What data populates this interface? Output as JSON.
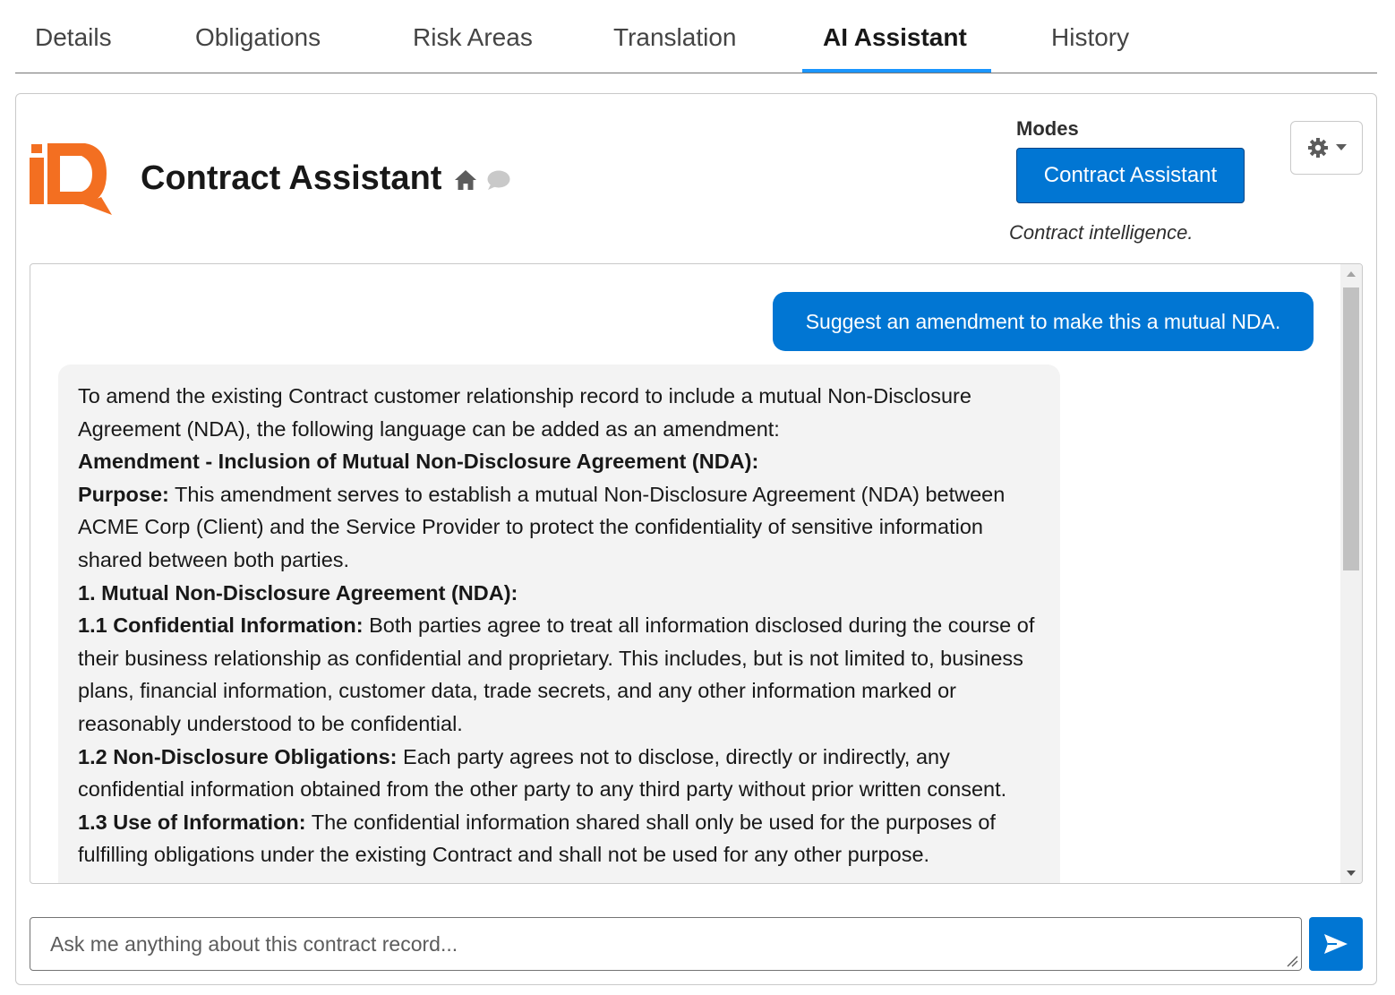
{
  "tabs": [
    {
      "label": "Details"
    },
    {
      "label": "Obligations"
    },
    {
      "label": "Risk Areas"
    },
    {
      "label": "Translation"
    },
    {
      "label": "AI Assistant",
      "active": true
    },
    {
      "label": "History"
    }
  ],
  "header": {
    "title": "Contract Assistant",
    "icons": [
      "home-icon",
      "chat-bubble-icon"
    ]
  },
  "modes": {
    "label": "Modes",
    "selected": "Contract Assistant",
    "description": "Contract intelligence."
  },
  "settings": {
    "icon": "gear-icon",
    "dropdown_icon": "caret-down-icon"
  },
  "conversation": {
    "user_message": "Suggest an amendment to make this a mutual NDA.",
    "assistant_message": {
      "intro": "To amend the existing Contract customer relationship record to include a mutual Non-Disclosure Agreement (NDA), the following language can be added as an amendment:",
      "heading": "Amendment - Inclusion of Mutual Non-Disclosure Agreement (NDA):",
      "purpose_label": "Purpose:",
      "purpose_text": " This amendment serves to establish a mutual Non-Disclosure Agreement (NDA) between ACME Corp (Client) and the Service Provider to protect the confidentiality of sensitive information shared between both parties.",
      "section1": "1. Mutual Non-Disclosure Agreement (NDA):",
      "s11_label": "1.1 Confidential Information:",
      "s11_text": " Both parties agree to treat all information disclosed during the course of their business relationship as confidential and proprietary. This includes, but is not limited to, business plans, financial information, customer data, trade secrets, and any other information marked or reasonably understood to be confidential.",
      "s12_label": "1.2 Non-Disclosure Obligations:",
      "s12_text": " Each party agrees not to disclose, directly or indirectly, any confidential information obtained from the other party to any third party without prior written consent.",
      "s13_label": "1.3 Use of Information:",
      "s13_text": " The confidential information shared shall only be used for the purposes of fulfilling obligations under the existing Contract and shall not be used for any other purpose."
    }
  },
  "input": {
    "placeholder": "Ask me anything about this contract record...",
    "value": ""
  },
  "send": {
    "icon": "send-icon"
  },
  "colors": {
    "brand_blue": "#0176d3",
    "tab_underline": "#1b96ff",
    "logo_orange": "#f36f21",
    "assistant_bubble": "#f3f3f3"
  }
}
